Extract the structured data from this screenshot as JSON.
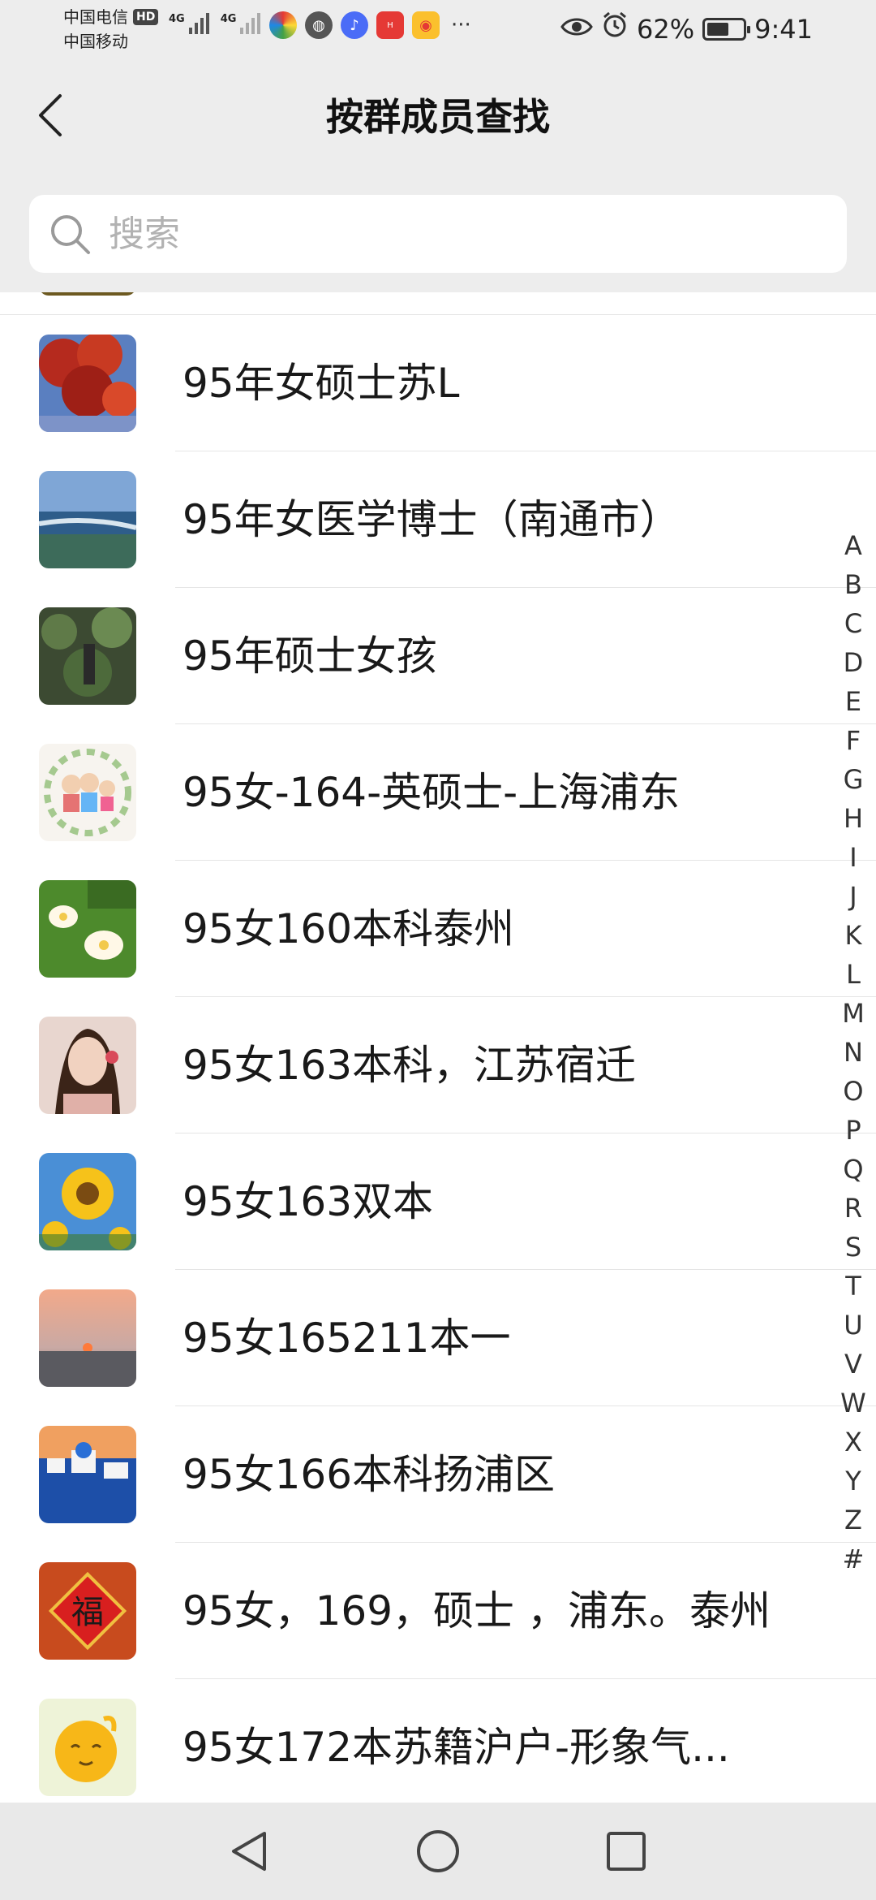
{
  "status_bar": {
    "carrier_1": "中国电信",
    "carrier_1_badge": "HD",
    "carrier_2": "中国移动",
    "network_1": "4G",
    "network_2": "4G",
    "more": "···",
    "battery": "62%",
    "battery_level": 0.62,
    "time": "9:41",
    "icons": [
      "eye-icon",
      "alarm-icon",
      "battery-icon"
    ],
    "app_icons": [
      "colorful-app-icon",
      "globe-app-icon",
      "music-app-icon",
      "huawei-app-icon",
      "weibo-app-icon"
    ]
  },
  "header": {
    "title": "按群成员查找",
    "back_icon": "chevron-left-icon"
  },
  "search": {
    "placeholder": "搜索"
  },
  "members": [
    {
      "name": "95年女硕士苏L",
      "avatar": "red-maple-photo"
    },
    {
      "name": "95年女医学博士（南通市）",
      "avatar": "seaside-photo"
    },
    {
      "name": "95年硕士女孩",
      "avatar": "garden-photo"
    },
    {
      "name": "95女-164-英硕士-上海浦东",
      "avatar": "cartoon-family-photo"
    },
    {
      "name": "95女160本科泰州",
      "avatar": "water-lily-photo"
    },
    {
      "name": "95女163本科，江苏宿迁",
      "avatar": "selfie-photo"
    },
    {
      "name": "95女163双本",
      "avatar": "sunflower-photo"
    },
    {
      "name": "95女165211本一",
      "avatar": "sunset-photo"
    },
    {
      "name": "95女166本科扬浦区",
      "avatar": "santorini-photo"
    },
    {
      "name": "95女，169，硕士 ，浦东。泰州",
      "avatar": "fu-character-photo"
    },
    {
      "name": "95女172本苏籍沪户-形象气...",
      "avatar": "cartoon-sun-photo"
    }
  ],
  "alpha_index": [
    "A",
    "B",
    "C",
    "D",
    "E",
    "F",
    "G",
    "H",
    "I",
    "J",
    "K",
    "L",
    "M",
    "N",
    "O",
    "P",
    "Q",
    "R",
    "S",
    "T",
    "U",
    "V",
    "W",
    "X",
    "Y",
    "Z",
    "#"
  ],
  "system_nav": [
    "back-triangle-icon",
    "home-circle-icon",
    "recent-square-icon"
  ],
  "colors": {
    "header_bg": "#ededed",
    "list_bg": "#ffffff",
    "text": "#191919",
    "placeholder": "#b2b2b2",
    "divider": "#e5e5e5"
  }
}
